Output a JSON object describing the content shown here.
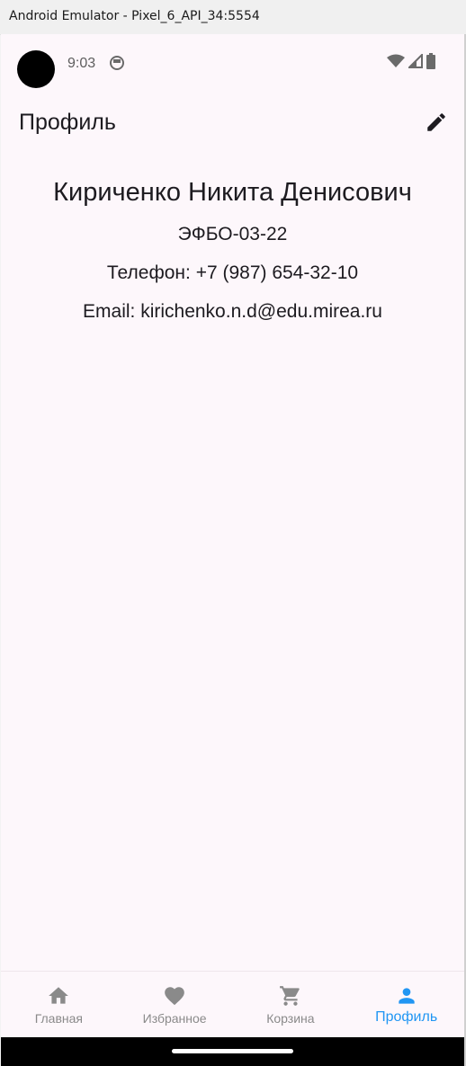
{
  "window": {
    "title": "Android Emulator - Pixel_6_API_34:5554"
  },
  "status_bar": {
    "time": "9:03",
    "icons": [
      "notification-icon",
      "wifi-icon",
      "signal-icon",
      "battery-icon"
    ]
  },
  "app_bar": {
    "title": "Профиль",
    "action_icon": "edit-icon"
  },
  "profile": {
    "full_name": "Кириченко Никита Денисович",
    "group": "ЭФБО-03-22",
    "phone_line": "Телефон: +7 (987) 654-32-10",
    "email_line": "Email: kirichenko.n.d@edu.mirea.ru"
  },
  "bottom_nav": {
    "items": [
      {
        "label": "Главная",
        "icon": "home-icon",
        "active": false
      },
      {
        "label": "Избранное",
        "icon": "heart-icon",
        "active": false
      },
      {
        "label": "Корзина",
        "icon": "cart-icon",
        "active": false
      },
      {
        "label": "Профиль",
        "icon": "person-icon",
        "active": true
      }
    ],
    "active_color": "#2196f3",
    "inactive_color": "#8a8a8a"
  },
  "colors": {
    "background": "#fdf7fb",
    "text": "#1d1b20"
  }
}
